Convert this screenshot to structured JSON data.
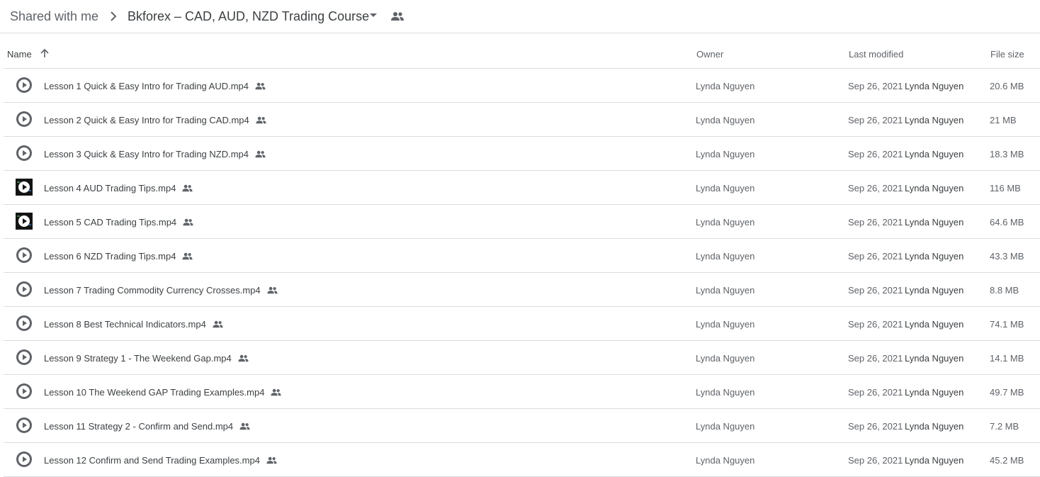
{
  "breadcrumb": {
    "root": "Shared with me",
    "current": "Bkforex – CAD, AUD, NZD Trading Course"
  },
  "columns": {
    "name": "Name",
    "owner": "Owner",
    "last_modified": "Last modified",
    "file_size": "File size"
  },
  "colors": {
    "text_primary": "#3c4043",
    "text_secondary": "#5f6368",
    "divider": "#dadce0",
    "icon_gray": "#5f6368"
  },
  "files": [
    {
      "name": "Lesson 1 Quick & Easy Intro for Trading AUD.mp4",
      "owner": "Lynda Nguyen",
      "date": "Sep 26, 2021",
      "modified_by": "Lynda Nguyen",
      "size": "20.6 MB",
      "thumb": "gray"
    },
    {
      "name": "Lesson 2 Quick & Easy Intro for Trading CAD.mp4",
      "owner": "Lynda Nguyen",
      "date": "Sep 26, 2021",
      "modified_by": "Lynda Nguyen",
      "size": "21 MB",
      "thumb": "gray"
    },
    {
      "name": "Lesson 3 Quick & Easy Intro for Trading NZD.mp4",
      "owner": "Lynda Nguyen",
      "date": "Sep 26, 2021",
      "modified_by": "Lynda Nguyen",
      "size": "18.3 MB",
      "thumb": "gray"
    },
    {
      "name": "Lesson 4 AUD Trading Tips.mp4",
      "owner": "Lynda Nguyen",
      "date": "Sep 26, 2021",
      "modified_by": "Lynda Nguyen",
      "size": "116 MB",
      "thumb": "dark"
    },
    {
      "name": "Lesson 5 CAD Trading Tips.mp4",
      "owner": "Lynda Nguyen",
      "date": "Sep 26, 2021",
      "modified_by": "Lynda Nguyen",
      "size": "64.6 MB",
      "thumb": "dark"
    },
    {
      "name": "Lesson 6 NZD Trading Tips.mp4",
      "owner": "Lynda Nguyen",
      "date": "Sep 26, 2021",
      "modified_by": "Lynda Nguyen",
      "size": "43.3 MB",
      "thumb": "gray"
    },
    {
      "name": "Lesson 7 Trading Commodity Currency Crosses.mp4",
      "owner": "Lynda Nguyen",
      "date": "Sep 26, 2021",
      "modified_by": "Lynda Nguyen",
      "size": "8.8 MB",
      "thumb": "gray"
    },
    {
      "name": "Lesson 8 Best Technical Indicators.mp4",
      "owner": "Lynda Nguyen",
      "date": "Sep 26, 2021",
      "modified_by": "Lynda Nguyen",
      "size": "74.1 MB",
      "thumb": "gray"
    },
    {
      "name": "Lesson 9 Strategy 1 - The Weekend Gap.mp4",
      "owner": "Lynda Nguyen",
      "date": "Sep 26, 2021",
      "modified_by": "Lynda Nguyen",
      "size": "14.1 MB",
      "thumb": "gray"
    },
    {
      "name": "Lesson 10 The Weekend GAP Trading Examples.mp4",
      "owner": "Lynda Nguyen",
      "date": "Sep 26, 2021",
      "modified_by": "Lynda Nguyen",
      "size": "49.7 MB",
      "thumb": "gray"
    },
    {
      "name": "Lesson 11 Strategy 2 - Confirm and Send.mp4",
      "owner": "Lynda Nguyen",
      "date": "Sep 26, 2021",
      "modified_by": "Lynda Nguyen",
      "size": "7.2 MB",
      "thumb": "gray"
    },
    {
      "name": "Lesson 12 Confirm and Send Trading Examples.mp4",
      "owner": "Lynda Nguyen",
      "date": "Sep 26, 2021",
      "modified_by": "Lynda Nguyen",
      "size": "45.2 MB",
      "thumb": "gray"
    }
  ]
}
